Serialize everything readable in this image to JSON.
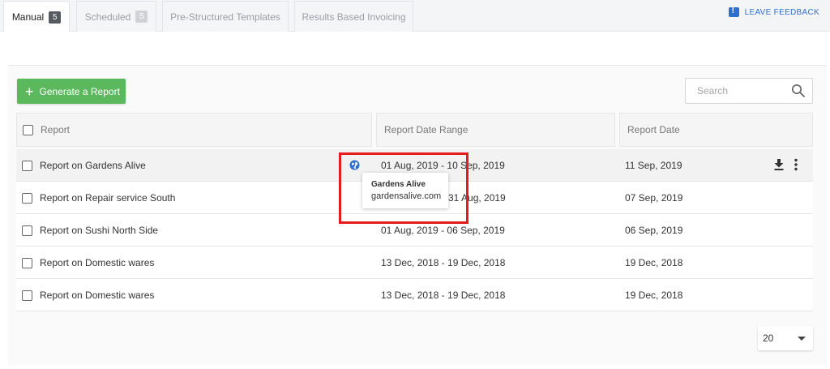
{
  "tabs": [
    {
      "label": "Manual",
      "count": "5"
    },
    {
      "label": "Scheduled",
      "count": "5"
    },
    {
      "label": "Pre-Structured Templates"
    },
    {
      "label": "Results Based Invoicing"
    }
  ],
  "feedback": {
    "label": "LEAVE FEEDBACK",
    "icon": "feedback-icon",
    "color": "#2f6fd0"
  },
  "toolbar": {
    "generate_label": "Generate a Report",
    "generate_color": "#5cb85c"
  },
  "search": {
    "placeholder": "Search",
    "value": ""
  },
  "table": {
    "columns": [
      "Report",
      "Report Date Range",
      "Report Date"
    ],
    "rows": [
      {
        "report": "Report on Gardens Alive",
        "range": "01 Aug, 2019 - 10 Sep, 2019",
        "date": "11 Sep, 2019"
      },
      {
        "report": "Report on Repair service South",
        "range": "31 Aug, 2019",
        "date": "07 Sep, 2019"
      },
      {
        "report": "Report on Sushi North Side",
        "range": "01 Aug, 2019 - 06 Sep, 2019",
        "date": "06 Sep, 2019"
      },
      {
        "report": "Report on Domestic wares",
        "range": "13 Dec, 2018 - 19 Dec, 2018",
        "date": "19 Dec, 2018"
      },
      {
        "report": "Report on Domestic wares",
        "range": "13 Dec, 2018 - 19 Dec, 2018",
        "date": "19 Dec, 2018"
      }
    ]
  },
  "tooltip": {
    "title": "Gardens Alive",
    "domain": "gardensalive.com"
  },
  "pagination": {
    "page_size": "20"
  },
  "colors": {
    "highlight": "#e41c1c",
    "accent": "#2f6fd0"
  }
}
